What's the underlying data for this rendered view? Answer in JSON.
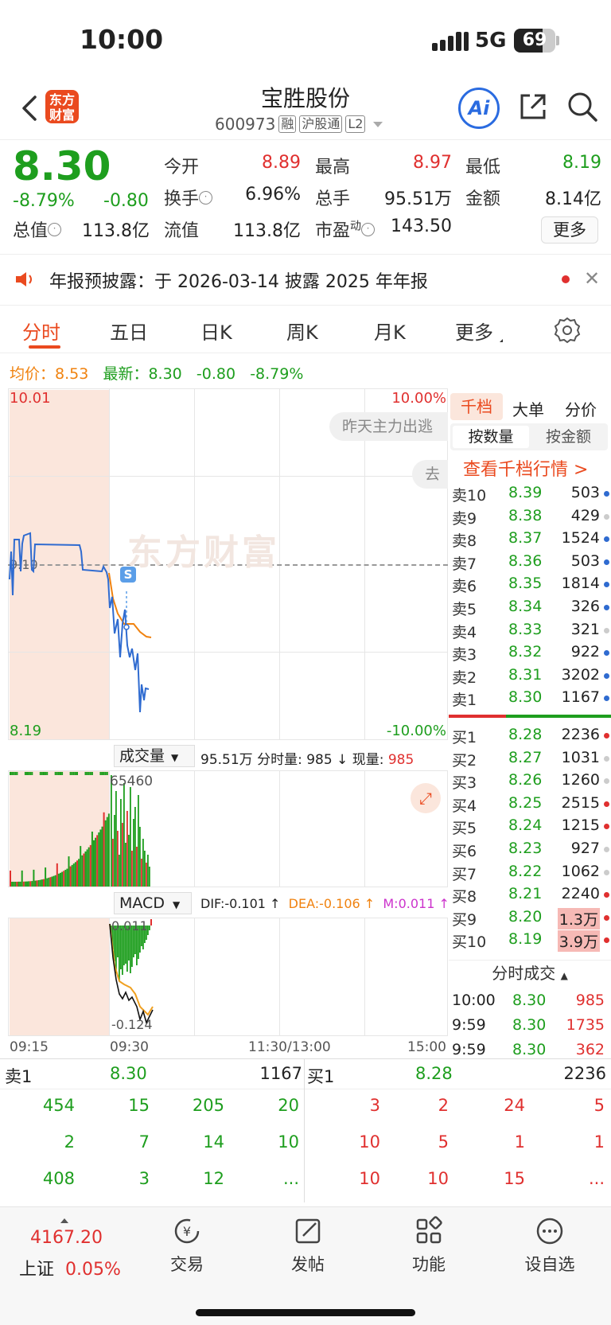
{
  "status": {
    "time": "10:00",
    "network": "5G",
    "battery": "69"
  },
  "header": {
    "logo_line1": "东方",
    "logo_line2": "财富",
    "title": "宝胜股份",
    "code": "600973",
    "tags": [
      "融",
      "沪股通",
      "L2"
    ],
    "ai_label": "Ai"
  },
  "quote": {
    "price": "8.30",
    "change_pct": "-8.79%",
    "change": "-0.80",
    "open_label": "今开",
    "open": "8.89",
    "high_label": "最高",
    "high": "8.97",
    "low_label": "最低",
    "low": "8.19",
    "turnover_label": "换手",
    "turnover": "6.96%",
    "volume_label": "总手",
    "volume": "95.51万",
    "amount_label": "金额",
    "amount": "8.14亿",
    "mktcap_label": "总值",
    "mktcap": "113.8亿",
    "float_label": "流值",
    "float": "113.8亿",
    "pe_label": "市盈",
    "pe_sup": "动",
    "pe": "143.50",
    "more_label": "更多"
  },
  "notice": {
    "text": "年报预披露：于 2026-03-14 披露 2025 年年报"
  },
  "tabs": {
    "items": [
      "分时",
      "五日",
      "日K",
      "周K",
      "月K",
      "更多"
    ],
    "active": "分时"
  },
  "avg": {
    "avg_label": "均价：",
    "avg_value": "8.53",
    "latest_label": "最新：",
    "latest_value": "8.30",
    "change": "-0.80",
    "pct": "-8.79%"
  },
  "chart": {
    "top_price": "10.01",
    "bottom_price": "8.19",
    "mid_price": "9.10",
    "top_pct": "10.00%",
    "bottom_pct": "-10.00%",
    "watermark": "东方财富",
    "bubble1": "昨天主力出逃",
    "bubble2": "去",
    "marker": "S",
    "volume_selector": "成交量",
    "volume_info": "95.51万 分时量: 985 ↓ 现量: ",
    "volume_now": "985",
    "volume_max": "65460",
    "macd_selector": "MACD",
    "dif": "DIF:-0.101 ↑",
    "dea": "DEA:-0.106 ↑",
    "m": "M:0.011 ↑",
    "macd_top": "0.011",
    "macd_bottom": "-0.124",
    "time_labels": [
      "09:15",
      "09:30",
      "11:30/13:00",
      "15:00"
    ]
  },
  "book": {
    "tabs": [
      "千档",
      "大单",
      "分价"
    ],
    "seg_on": "按数量",
    "seg_off": "按金额",
    "link": "查看千档行情 >",
    "sells": [
      {
        "label": "卖10",
        "price": "8.39",
        "vol": "503",
        "dot": "blue"
      },
      {
        "label": "卖9",
        "price": "8.38",
        "vol": "429",
        "dot": "gray"
      },
      {
        "label": "卖8",
        "price": "8.37",
        "vol": "1524",
        "dot": "blue"
      },
      {
        "label": "卖7",
        "price": "8.36",
        "vol": "503",
        "dot": "blue"
      },
      {
        "label": "卖6",
        "price": "8.35",
        "vol": "1814",
        "dot": "blue"
      },
      {
        "label": "卖5",
        "price": "8.34",
        "vol": "326",
        "dot": "blue"
      },
      {
        "label": "卖4",
        "price": "8.33",
        "vol": "321",
        "dot": "gray"
      },
      {
        "label": "卖3",
        "price": "8.32",
        "vol": "922",
        "dot": "blue"
      },
      {
        "label": "卖2",
        "price": "8.31",
        "vol": "3202",
        "dot": "blue"
      },
      {
        "label": "卖1",
        "price": "8.30",
        "vol": "1167",
        "dot": "blue"
      }
    ],
    "buys": [
      {
        "label": "买1",
        "price": "8.28",
        "vol": "2236",
        "dot": "red"
      },
      {
        "label": "买2",
        "price": "8.27",
        "vol": "1031",
        "dot": "gray"
      },
      {
        "label": "买3",
        "price": "8.26",
        "vol": "1260",
        "dot": "gray"
      },
      {
        "label": "买4",
        "price": "8.25",
        "vol": "2515",
        "dot": "red"
      },
      {
        "label": "买5",
        "price": "8.24",
        "vol": "1215",
        "dot": "red"
      },
      {
        "label": "买6",
        "price": "8.23",
        "vol": "927",
        "dot": "gray"
      },
      {
        "label": "买7",
        "price": "8.22",
        "vol": "1062",
        "dot": "gray"
      },
      {
        "label": "买8",
        "price": "8.21",
        "vol": "2240",
        "dot": "red"
      },
      {
        "label": "买9",
        "price": "8.20",
        "vol": "1.3万",
        "dot": "red"
      },
      {
        "label": "买10",
        "price": "8.19",
        "vol": "3.9万",
        "dot": "red"
      }
    ],
    "ticks_title": "分时成交",
    "ticks": [
      {
        "time": "10:00",
        "price": "8.30",
        "vol": "985"
      },
      {
        "time": "9:59",
        "price": "8.30",
        "vol": "1735"
      },
      {
        "time": "9:59",
        "price": "8.30",
        "vol": "362"
      }
    ]
  },
  "level1": {
    "sell_label": "卖1",
    "sell_price": "8.30",
    "sell_vol": "1167",
    "buy_label": "买1",
    "buy_price": "8.28",
    "buy_vol": "2236",
    "sell_rows": [
      [
        "454",
        "15",
        "205",
        "20"
      ],
      [
        "2",
        "7",
        "14",
        "10"
      ],
      [
        "408",
        "3",
        "12",
        "..."
      ]
    ],
    "buy_rows": [
      [
        "3",
        "2",
        "24",
        "5"
      ],
      [
        "10",
        "5",
        "1",
        "1"
      ],
      [
        "10",
        "10",
        "15",
        "..."
      ]
    ]
  },
  "nav": {
    "index_value": "4167.20",
    "index_name": "上证",
    "index_pct": "0.05%",
    "items": [
      "交易",
      "发帖",
      "功能",
      "设自选"
    ]
  }
}
